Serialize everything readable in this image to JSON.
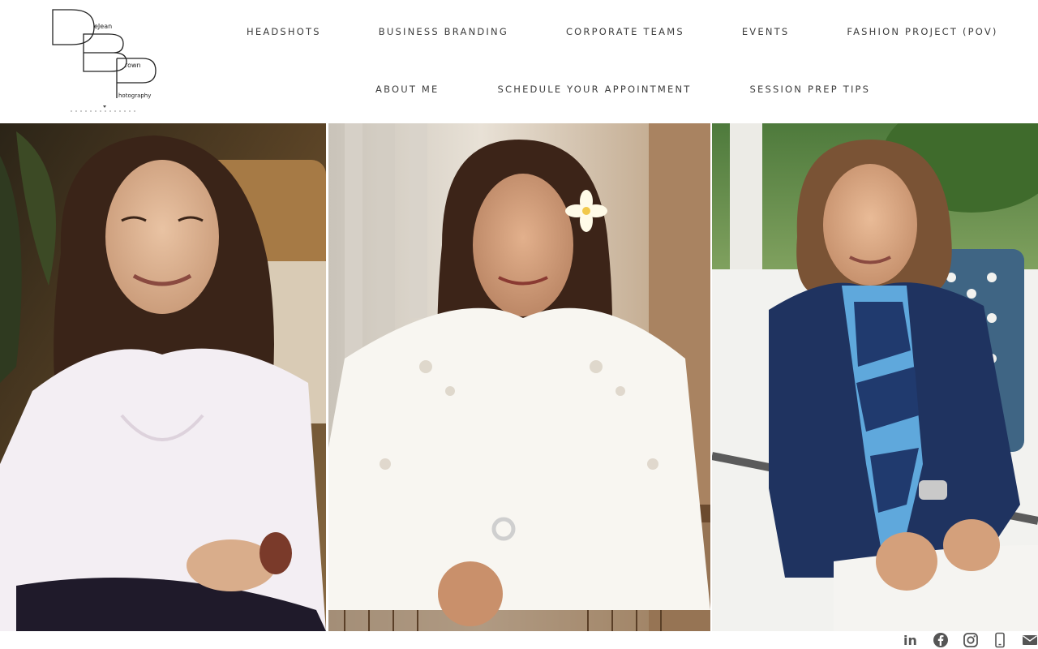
{
  "brand": {
    "logo_initials": [
      "D",
      "B",
      "P"
    ],
    "logo_words": [
      "eJean",
      "rown",
      "hotography"
    ],
    "logo_color": "#222222"
  },
  "nav": {
    "row1": [
      {
        "label": "HEADSHOTS"
      },
      {
        "label": "BUSINESS BRANDING"
      },
      {
        "label": "CORPORATE TEAMS"
      },
      {
        "label": "EVENTS"
      },
      {
        "label": "FASHION PROJECT (POV)"
      }
    ],
    "row2": [
      {
        "label": "ABOUT ME"
      },
      {
        "label": "SCHEDULE YOUR APPOINTMENT"
      },
      {
        "label": "SESSION PREP TIPS"
      }
    ],
    "text_color": "#3d3d3d"
  },
  "gallery": {
    "photos": [
      {
        "subject": "woman in white embroidered blouse, warm interior"
      },
      {
        "subject": "woman in white lace blouse with flower in hair, seated on wooden chair"
      },
      {
        "subject": "woman in navy blazer and striped scarf, outdoor sofa"
      }
    ]
  },
  "social": {
    "icons": [
      "linkedin-icon",
      "facebook-icon",
      "instagram-icon",
      "phone-icon",
      "email-icon"
    ],
    "icon_color": "#555555",
    "linkedin_text": "in"
  }
}
